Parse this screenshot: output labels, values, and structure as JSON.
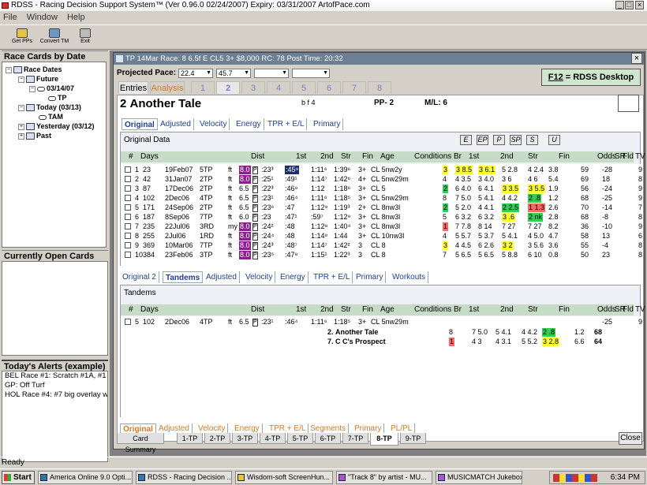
{
  "window": {
    "title": "RDSS - Racing Decision Support System™ (Ver 0.96.0  02/24/2007)  Expiry: 03/31/2007          ArtofPace.com",
    "min": "_",
    "max": "□",
    "close": "×"
  },
  "menu": [
    "File",
    "Window",
    "Help"
  ],
  "toolbar": [
    "Get PPs",
    "Convert TM",
    "Exit"
  ],
  "left": {
    "race_cards_title": "Race Cards by Date",
    "tree": {
      "race_dates": "Race Dates",
      "future": "Future",
      "d0314": "03/14/07",
      "tp": "TP",
      "today": "Today (03/13)",
      "tam": "TAM",
      "yesterday": "Yesterday (03/12)",
      "past": "Past"
    },
    "open_cards_title": "Currently Open Cards",
    "alerts_title": "Today's Alerts (example)",
    "alerts": [
      "BEL Race #1: Scratch #1A, #1",
      "GP: Off Turf",
      "HOL Race #4: #7 big overlay w"
    ]
  },
  "card": {
    "title": "TP 14Mar Race: 8          6.5f  E  CL5  3+  $8,000  RC: 78          Post Time: 20:32",
    "close": "×",
    "projected_pace_label": "Projected Pace:",
    "pace_values": [
      "22.4",
      "45.7",
      "",
      ""
    ],
    "e12_key": "F12",
    "e12_text": " = RDSS Desktop",
    "tabs": [
      "Entries",
      "Analysis",
      "1",
      "2",
      "3",
      "4",
      "5",
      "6",
      "7",
      "8"
    ],
    "horse_num": "2",
    "horse_name": "Another Tale",
    "horse_sex": "b f 4",
    "pp": "PP- 2",
    "ml": "M/L:  6",
    "subtabs": [
      "Original",
      "Adjusted",
      "Velocity",
      "Energy",
      "TPR + E/L",
      "Primary"
    ],
    "original_data_label": "Original Data",
    "filter_buttons": [
      "E",
      "EP",
      "P",
      "SP",
      "S",
      "U"
    ],
    "headers": [
      "#",
      "Days",
      "Dist",
      "1st",
      "2nd",
      "Str",
      "Fin",
      "Age",
      "Conditions",
      "Br",
      "1st",
      "2nd",
      "Str",
      "Fin",
      "Odds",
      "SR",
      "TV",
      "Fld"
    ],
    "rows": [
      [
        "1",
        "23",
        "19Feb07",
        "5TP",
        "ft",
        "8.0",
        "P",
        ":23³",
        ":45⁹",
        "1:11⁶",
        "1:39⁶",
        "3+",
        "CL 5nw2y",
        "3",
        "3 8.5",
        "3 6.1",
        "5 2.8",
        "4 2.4",
        "3.8",
        "59",
        "-28",
        "9"
      ],
      [
        "2",
        "42",
        "31Jan07",
        "2TP",
        "ft",
        "8.0",
        "P",
        ":25¹",
        ":49¹",
        "1:14⁷",
        "1:42⁶",
        "4+",
        "CL 5nw29m",
        "4",
        "4 3.5",
        "3 4.0",
        "3 6",
        "4 6",
        "5.4",
        "69",
        "18",
        "8"
      ],
      [
        "3",
        "87",
        "17Dec06",
        "2TP",
        "ft",
        "6.5",
        "P",
        ":22³",
        ":46⁹",
        "1:12",
        "1:18⁶",
        "3+",
        "CL 5",
        "2",
        "6 4.0",
        "6 4.1",
        "3 3.5",
        "3 5.5",
        "1.9",
        "56",
        "-24",
        "9"
      ],
      [
        "4",
        "102",
        "2Dec06",
        "4TP",
        "ft",
        "6.5",
        "P",
        ":23¹",
        ":46⁴",
        "1:11⁶",
        "1:18⁵",
        "3+",
        "CL 5nw29m",
        "8",
        "7 5.0",
        "5 4.1",
        "4 4.2",
        "2 .8",
        "1.2",
        "68",
        "-25",
        "9"
      ],
      [
        "5",
        "171",
        "24Sep06",
        "2TP",
        "ft",
        "6.5",
        "P",
        ":23⁶",
        ":47",
        "1:12⁹",
        "1:19³",
        "2+",
        "CL 8nw3l",
        "2",
        "5 2.0",
        "4 4.1",
        "2 2.5",
        "1 1.3",
        "2.6",
        "70",
        "-14",
        "7"
      ],
      [
        "6",
        "187",
        "8Sep06",
        "7TP",
        "ft",
        "6.0",
        "P",
        ":23",
        ":47¹",
        ":59⁷",
        "1:12⁹",
        "3+",
        "CL 8nw3l",
        "5",
        "6 3.2",
        "6 3.2",
        "3 .6",
        "2 nk",
        "2.8",
        "68",
        "-8",
        "8"
      ],
      [
        "7",
        "235",
        "22Jul06",
        "3RD",
        "my",
        "8.0",
        "P",
        ":24²",
        ":48",
        "1:12⁸",
        "1:40⁴",
        "3+",
        "CL 8nw3l",
        "1",
        "7 7.8",
        "8 14",
        "7 27",
        "7 27",
        "8.2",
        "36",
        "-10",
        "9"
      ],
      [
        "8",
        "255",
        "2Jul06",
        "1RD",
        "ft",
        "8.0",
        "P",
        ":24⁴",
        ":48",
        "1:14⁸",
        "1:44",
        "3+",
        "CL 10nw3l",
        "4",
        "5 5.7",
        "5 3.7",
        "5 4.1",
        "4 5.0",
        "4.7",
        "58",
        "13",
        "6"
      ],
      [
        "9",
        "369",
        "10Mar06",
        "7TP",
        "ft",
        "8.0",
        "P",
        ":24³",
        ":48⁷",
        "1:14⁷",
        "1:42²",
        "3",
        "CL 8",
        "3",
        "4 4.5",
        "6 2.6",
        "3 2",
        "3 5.6",
        "3.6",
        "55",
        "-4",
        "8"
      ],
      [
        "10",
        "384",
        "23Feb06",
        "3TP",
        "ft",
        "8.0",
        "P",
        ":23⁵",
        ":47⁸",
        "1:15¹",
        "1:22³",
        "3",
        "CL 8",
        "7",
        "5 6.5",
        "5 6.5",
        "5 8.8",
        "6 10",
        "0.8",
        "50",
        "23",
        "8"
      ]
    ],
    "subtabs2": [
      "Original 2",
      "Tandems",
      "Adjusted",
      "Velocity",
      "Energy",
      "TPR + E/L",
      "Primary",
      "Workouts"
    ],
    "tandems_label": "Tandems",
    "tandem_row": [
      "5",
      "102",
      "2Dec06",
      "4TP",
      "ft",
      "6.5",
      "P",
      ":23¹",
      ":46⁴",
      "1:11⁶",
      "1:18⁵",
      "3+",
      "CL 5nw29m",
      "",
      "",
      "",
      "",
      "",
      "",
      "",
      "-25",
      "9"
    ],
    "tandem_horses": [
      [
        "2.",
        "Another Tale",
        "8",
        "7 5.0",
        "5 4.1",
        "4 4.2",
        "2 .8",
        "1.2",
        "68"
      ],
      [
        "7.",
        "C C's Prospect",
        "1",
        "4 3",
        "4 3.1",
        "5 5.2",
        "3 2.8",
        "6.6",
        "64"
      ]
    ],
    "subtabs3": [
      "Original",
      "Adjusted",
      "Velocity",
      "Energy",
      "TPR + E/L",
      "Segments",
      "Primary",
      "PL/PL"
    ],
    "bottom_tabs": [
      "Card Summary",
      "1-TP",
      "2-TP",
      "3-TP",
      "4-TP",
      "5-TP",
      "6-TP",
      "7-TP",
      "8-TP",
      "9-TP"
    ],
    "close_button": "Close"
  },
  "status": "Ready",
  "taskbar": {
    "start": "Start",
    "tasks": [
      "America Online 9.0 Opti...",
      "RDSS - Racing Decision ...",
      "Wisdom-soft ScreenHun...",
      "\"Track 8\" by artist - MU...",
      "MUSICMATCH Jukebox"
    ],
    "clock": "6:34 PM"
  }
}
